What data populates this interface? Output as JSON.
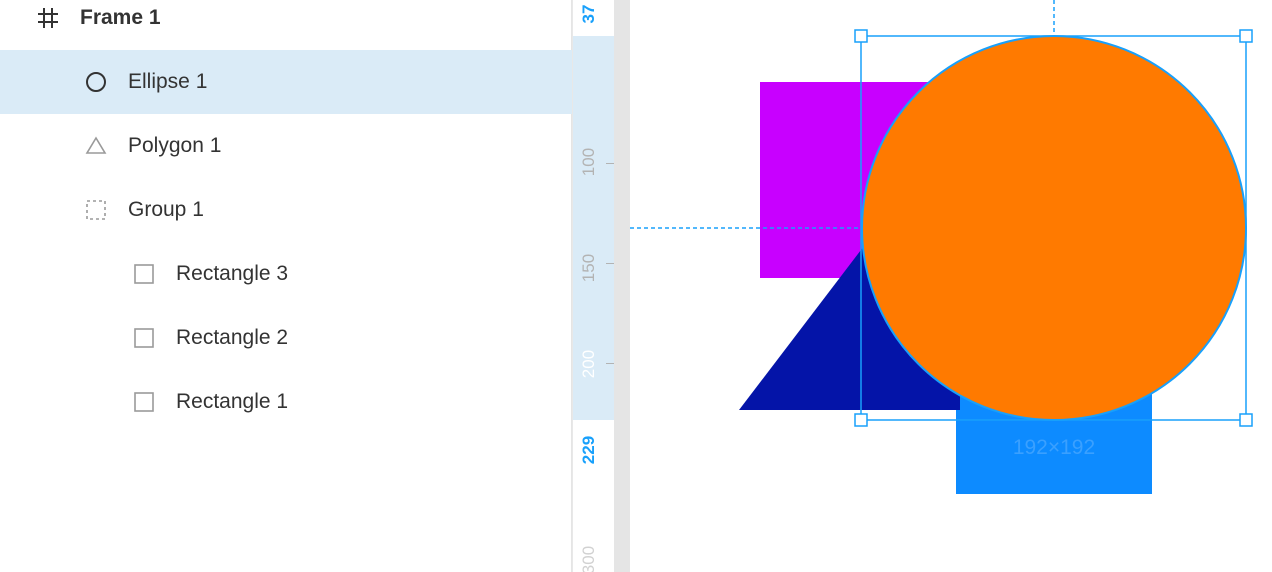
{
  "layers": {
    "frame": {
      "label": "Frame 1",
      "icon": "frame-icon"
    },
    "items": [
      {
        "label": "Ellipse 1",
        "icon": "ellipse-icon",
        "selected": true
      },
      {
        "label": "Polygon 1",
        "icon": "polygon-icon",
        "selected": false
      },
      {
        "label": "Group 1",
        "icon": "group-icon",
        "selected": false
      },
      {
        "label": "Rectangle 3",
        "icon": "rectangle-icon",
        "selected": false
      },
      {
        "label": "Rectangle 2",
        "icon": "rectangle-icon",
        "selected": false
      },
      {
        "label": "Rectangle 1",
        "icon": "rectangle-icon",
        "selected": false
      }
    ]
  },
  "ruler": {
    "selection_start": "37",
    "tick_100": "100",
    "tick_150": "150",
    "tick_200": "200",
    "selection_end": "229",
    "tick_300": "300"
  },
  "canvas": {
    "size_label": "192×192"
  },
  "colors": {
    "selection": "#18a0fb",
    "selected_row": "#daebf7",
    "ellipse": "#ff7a00",
    "polygon": "#0414a8",
    "rect_purple": "#c800ff",
    "rect_blue": "#0d8bff"
  }
}
